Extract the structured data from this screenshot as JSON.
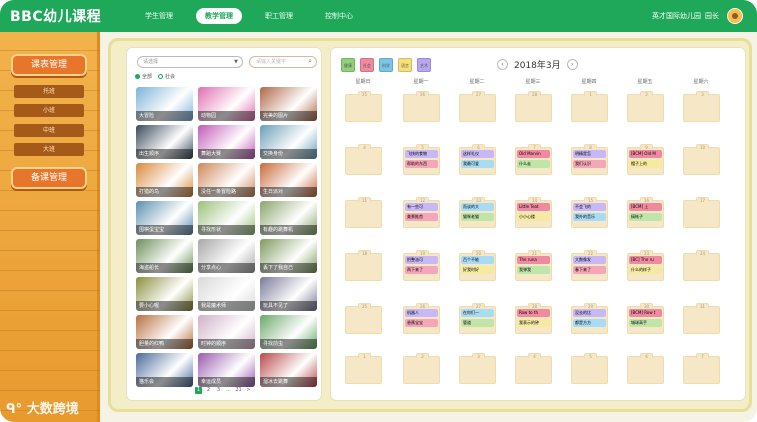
{
  "app": {
    "brand": "BBC幼儿课程"
  },
  "nav": {
    "items": [
      "学生管理",
      "教学管理",
      "职工管理",
      "控制中心"
    ],
    "active_index": 1
  },
  "user": {
    "school": "英才国际幼儿园",
    "role": "园长"
  },
  "sidebar": {
    "section1": "课表管理",
    "classes": [
      "托班",
      "小班",
      "中班",
      "大班"
    ],
    "section2": "备课管理"
  },
  "watermark": "大数跨境",
  "library": {
    "select_placeholder": "请选择",
    "search_placeholder": "请输入关键字",
    "radios": [
      {
        "label": "全部",
        "checked": true
      },
      {
        "label": "社会",
        "checked": false
      }
    ],
    "items": [
      {
        "title": "大冒险",
        "color": "#7db3d8"
      },
      {
        "title": "动物园",
        "color": "#e06fb0"
      },
      {
        "title": "完美的图片",
        "color": "#b06848"
      },
      {
        "title": "出生顺序",
        "color": "#3a4a5a"
      },
      {
        "title": "舞蹈大赛",
        "color": "#c15bb8"
      },
      {
        "title": "交换身份",
        "color": "#6a9fb8"
      },
      {
        "title": "打猎的鸟",
        "color": "#d88a3c"
      },
      {
        "title": "没任一条冒险路",
        "color": "#cf8858"
      },
      {
        "title": "生日派对",
        "color": "#c86a3a"
      },
      {
        "title": "围棋蛋宝宝",
        "color": "#5c8fb0"
      },
      {
        "title": "寻找形状",
        "color": "#9cc07a"
      },
      {
        "title": "有趣的跳舞机",
        "color": "#8aa56c"
      },
      {
        "title": "海盗船长",
        "color": "#6d8f5c"
      },
      {
        "title": "分享点心",
        "color": "#a7a7a7"
      },
      {
        "title": "丢下了我自己",
        "color": "#7d9a5c"
      },
      {
        "title": "要小心喔",
        "color": "#8a8f3c"
      },
      {
        "title": "我是魔术师",
        "color": "#d9d9d9"
      },
      {
        "title": "玩具不见了",
        "color": "#7a7a9a"
      },
      {
        "title": "胆量的红鸭",
        "color": "#b87040"
      },
      {
        "title": "时钟的顺序",
        "color": "#d0b0c8"
      },
      {
        "title": "寻找前虫",
        "color": "#6aa86a"
      },
      {
        "title": "猫乐会",
        "color": "#4a6a9a"
      },
      {
        "title": "幸运成员",
        "color": "#9a5ab0"
      },
      {
        "title": "溜冰去跳舞",
        "color": "#b84a4a"
      }
    ],
    "pager": [
      "1",
      "2",
      "3",
      "...",
      "21",
      ">"
    ],
    "pager_active": 0
  },
  "calendar": {
    "tools": [
      {
        "label": "健康",
        "color": "#8fd07a"
      },
      {
        "label": "社会",
        "color": "#f08aa0"
      },
      {
        "label": "科学",
        "color": "#7ac6e8"
      },
      {
        "label": "语言",
        "color": "#f5e07a"
      },
      {
        "label": "艺术",
        "color": "#b9a6f0"
      }
    ],
    "month_label": "2018年3月",
    "weekdays": [
      "星期日",
      "星期一",
      "星期二",
      "星期三",
      "星期四",
      "星期五",
      "星期六"
    ],
    "weeks": [
      [
        {
          "d": "25"
        },
        {
          "d": "26"
        },
        {
          "d": "27"
        },
        {
          "d": "28"
        },
        {
          "d": "1"
        },
        {
          "d": "2"
        },
        {
          "d": "3"
        }
      ],
      [
        {
          "d": "4"
        },
        {
          "d": "5",
          "c": [
            {
              "t": "飞快的食物",
              "col": "#c8b8f5"
            },
            {
              "t": "帮助的东西",
              "col": "#f5a6b8"
            }
          ]
        },
        {
          "d": "6",
          "c": [
            {
              "t": "这样礼仪",
              "col": "#c8b8f5"
            },
            {
              "t": "我最可爱",
              "col": "#a8dcf5"
            }
          ]
        },
        {
          "d": "7",
          "c": [
            {
              "t": "Old Marvin",
              "col": "#f08aa0"
            },
            {
              "t": "什么走",
              "col": "#bfe6a8"
            }
          ]
        },
        {
          "d": "8",
          "c": [
            {
              "t": "明精是怎",
              "col": "#c8b8f5"
            },
            {
              "t": "我们认识",
              "col": "#f5a6b8"
            }
          ]
        },
        {
          "d": "9",
          "c": [
            {
              "t": "[BCM] Old M",
              "col": "#f08aa0"
            },
            {
              "t": "帽子上的",
              "col": "#f5eaa0"
            }
          ]
        },
        {
          "d": "10"
        }
      ],
      [
        {
          "d": "11"
        },
        {
          "d": "12",
          "c": [
            {
              "t": "有一些可",
              "col": "#c8b8f5"
            },
            {
              "t": "美景推首",
              "col": "#f5a6b8"
            }
          ]
        },
        {
          "d": "13",
          "c": [
            {
              "t": "而谈的大",
              "col": "#a8dcf5"
            },
            {
              "t": "猫咪老猫",
              "col": "#bfe6a8"
            }
          ]
        },
        {
          "d": "14",
          "c": [
            {
              "t": "Little Teat",
              "col": "#f08aa0"
            },
            {
              "t": "小小心楼",
              "col": "#f5eaa0"
            }
          ]
        },
        {
          "d": "15",
          "c": [
            {
              "t": "不会飞的",
              "col": "#c8b8f5"
            },
            {
              "t": "我外的音乐",
              "col": "#a8dcf5"
            }
          ]
        },
        {
          "d": "16",
          "c": [
            {
              "t": "[BCM] 上",
              "col": "#f08aa0"
            },
            {
              "t": "搞帐子",
              "col": "#bfe6a8"
            }
          ]
        },
        {
          "d": "17"
        }
      ],
      [
        {
          "d": "18"
        },
        {
          "d": "19",
          "c": [
            {
              "t": "把整油可",
              "col": "#c8b8f5"
            },
            {
              "t": "两下来了",
              "col": "#f5a6b8"
            }
          ]
        },
        {
          "d": "20",
          "c": [
            {
              "t": "百个不能",
              "col": "#a8dcf5"
            },
            {
              "t": "好我时好",
              "col": "#f5eaa0"
            }
          ]
        },
        {
          "d": "21",
          "c": [
            {
              "t": "The runa",
              "col": "#f08aa0"
            },
            {
              "t": "我弹我",
              "col": "#bfe6a8"
            }
          ]
        },
        {
          "d": "22",
          "c": [
            {
              "t": "大数像发",
              "col": "#c8b8f5"
            },
            {
              "t": "春下来了",
              "col": "#f5a6b8"
            }
          ]
        },
        {
          "d": "23",
          "c": [
            {
              "t": "[BC] The ru",
              "col": "#f08aa0"
            },
            {
              "t": "什么的样子",
              "col": "#f5eaa0"
            }
          ]
        },
        {
          "d": "24"
        }
      ],
      [
        {
          "d": "25"
        },
        {
          "d": "26",
          "c": [
            {
              "t": "机器人",
              "col": "#c8b8f5"
            },
            {
              "t": "香蕉宝宝",
              "col": "#f5a6b8"
            }
          ]
        },
        {
          "d": "27",
          "c": [
            {
              "t": "在你们一",
              "col": "#a8dcf5"
            },
            {
              "t": "管道",
              "col": "#bfe6a8"
            }
          ]
        },
        {
          "d": "28",
          "c": [
            {
              "t": "Row to th",
              "col": "#f08aa0"
            },
            {
              "t": "我表示的钟",
              "col": "#f5eaa0"
            }
          ]
        },
        {
          "d": "29",
          "c": [
            {
              "t": "没去的比",
              "col": "#c8b8f5"
            },
            {
              "t": "都是方方",
              "col": "#a8dcf5"
            }
          ]
        },
        {
          "d": "30",
          "c": [
            {
              "t": "[BCM] Row t",
              "col": "#f08aa0"
            },
            {
              "t": "城球高手",
              "col": "#bfe6a8"
            }
          ]
        },
        {
          "d": "31"
        }
      ],
      [
        {
          "d": "1"
        },
        {
          "d": "2"
        },
        {
          "d": "3"
        },
        {
          "d": "4"
        },
        {
          "d": "5"
        },
        {
          "d": "6"
        },
        {
          "d": "7"
        }
      ]
    ]
  }
}
